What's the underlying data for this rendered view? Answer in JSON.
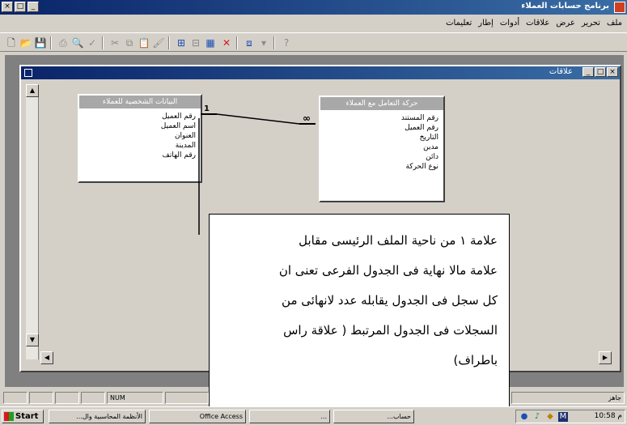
{
  "window": {
    "title": "برنامج حسابات العملاء"
  },
  "menu": [
    "ملف",
    "تحرير",
    "عرض",
    "علاقات",
    "أدوات",
    "إطار",
    "تعليمات"
  ],
  "child_window": {
    "title": "علاقات"
  },
  "tables": {
    "customers": {
      "title": "البيانات الشخصية للعملاء",
      "fields": [
        "رقم العميل",
        "اسم العميل",
        "العنوان",
        "المدينة",
        "رقم الهاتف"
      ]
    },
    "transactions": {
      "title": "حركة التعامل مع العملاء",
      "fields": [
        "رقم المستند",
        "رقم العميل",
        "التاريخ",
        "مدين",
        "دائن",
        "نوع الحركة"
      ]
    }
  },
  "relationship": {
    "one_label": "1",
    "many_label": "∞"
  },
  "callout": {
    "lines": [
      "علامة ١ من ناحية الملف الرئيسى مقابل",
      "علامة مالا نهاية فى الجدول الفرعى تعنى ان",
      "كل سجل فى الجدول يقابله عدد لانهائى من",
      "السجلات فى الجدول المرتبط ( علاقة راس",
      "باطراف)"
    ]
  },
  "statusbar": {
    "mode": "NUM",
    "ready": "جاهز"
  },
  "taskbar": {
    "start": "Start",
    "tasks": [
      "الأنظمة المحاسبية وال...",
      "Office Access",
      "...",
      "حساب..."
    ],
    "clock": "10:58 م"
  }
}
